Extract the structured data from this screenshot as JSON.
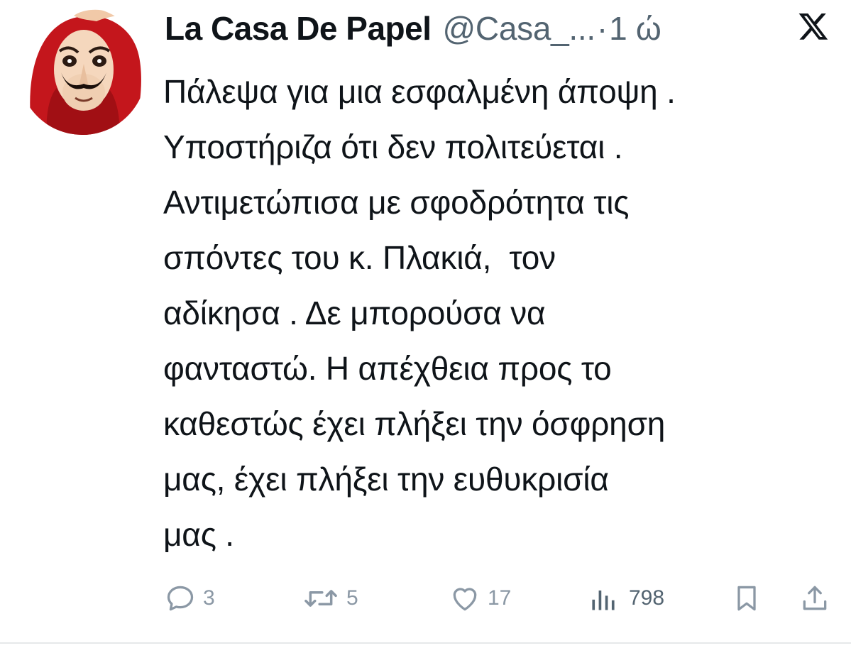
{
  "author": {
    "display_name": "La Casa De Papel",
    "handle": "@Casa_...",
    "separator": "·",
    "time": "1 ώ"
  },
  "icons": {
    "avatar": "dali-mask-avatar",
    "platform": "x-logo-icon",
    "reply": "reply-icon",
    "retweet": "retweet-icon",
    "like": "heart-icon",
    "views": "views-chart-icon",
    "bookmark": "bookmark-icon",
    "share": "share-icon"
  },
  "post": {
    "lines": [
      "Πάλεψα για μια εσφαλμένη άποψη .",
      "Υποστήριζα ότι δεν πολιτεύεται .",
      "Αντιμετώπισα με σφοδρότητα τις",
      "σπόντες του κ. Πλακιά,  τον",
      "αδίκησα . Δε μπορούσα να",
      "φανταστώ. Η απέχθεια προς το",
      "καθεστώς έχει πλήξει την όσφρηση",
      "μας, έχει πλήξει την ευθυκρισία",
      "μας ."
    ]
  },
  "metrics": {
    "replies": "3",
    "retweets": "5",
    "likes": "17",
    "views": "798"
  },
  "colors": {
    "text_primary": "#0f1419",
    "text_secondary": "#536471",
    "icon_gray": "#8b98a5",
    "mask_red": "#c4161c"
  }
}
